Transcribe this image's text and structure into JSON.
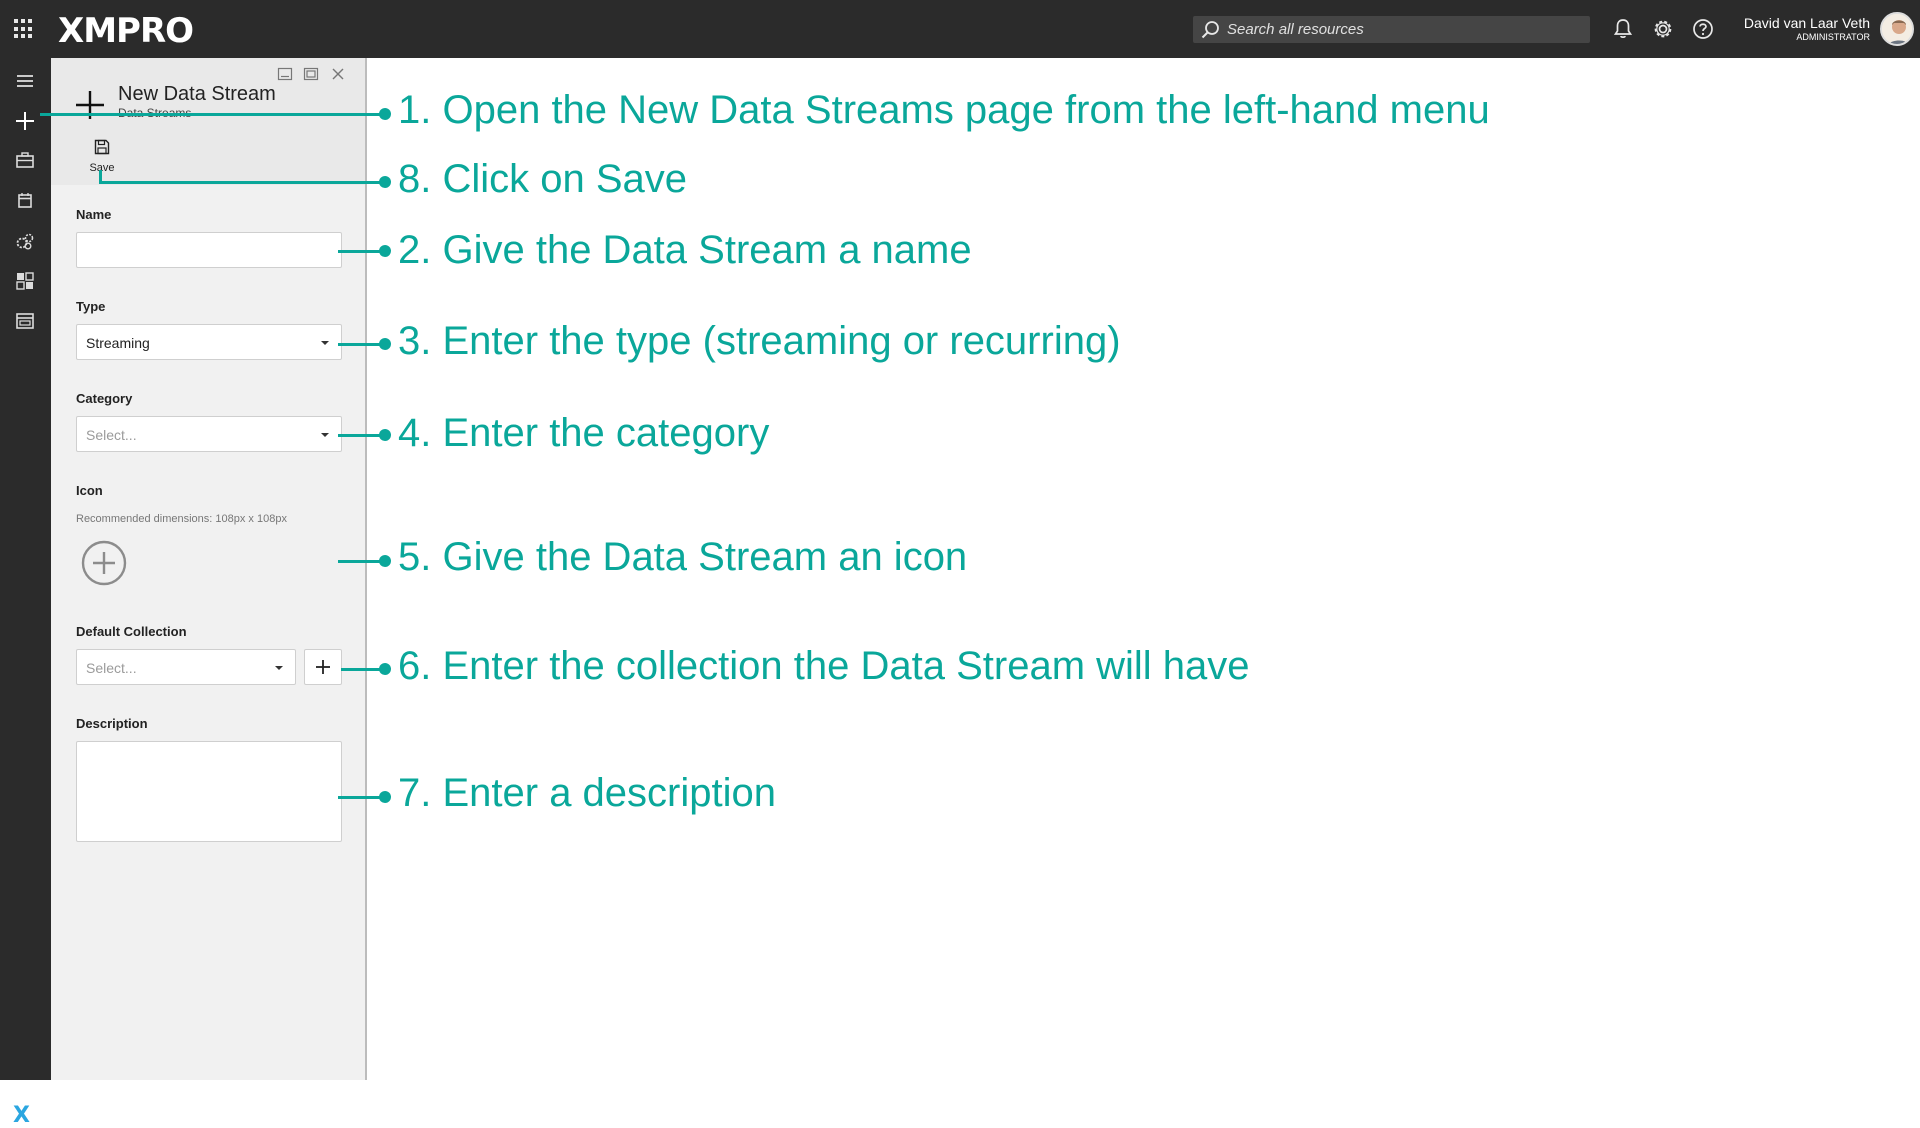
{
  "app": {
    "logo": "XMPRO",
    "search_placeholder": "Search all resources",
    "user_name": "David van Laar Veth",
    "user_role": "ADMINISTRATOR"
  },
  "panel": {
    "title": "New Data Stream",
    "subtitle": "Data Streams",
    "save_label": "Save",
    "fields": {
      "name_label": "Name",
      "name_value": "",
      "type_label": "Type",
      "type_value": "Streaming",
      "category_label": "Category",
      "category_placeholder": "Select...",
      "icon_label": "Icon",
      "icon_hint": "Recommended dimensions: 108px x 108px",
      "collection_label": "Default Collection",
      "collection_placeholder": "Select...",
      "description_label": "Description",
      "description_value": ""
    }
  },
  "annotations": {
    "step1": "1. Open the New Data Streams page from the left-hand menu",
    "step8": "8. Click on Save",
    "step2": "2. Give the Data Stream a name",
    "step3": "3. Enter the type (streaming or recurring)",
    "step4": "4. Enter the category",
    "step5": "5. Give the Data Stream an icon",
    "step6": "6. Enter the collection the Data Stream will have",
    "step7": "7. Enter a description"
  },
  "colors": {
    "annotation": "#0aa79a",
    "topbar": "#2b2b2b",
    "brand_x": "#2aa6e0"
  },
  "icons": [
    "apps-grid-icon",
    "bell-icon",
    "gear-icon",
    "help-icon",
    "search-icon",
    "menu-icon",
    "plus-icon",
    "briefcase-icon",
    "calendar-icon",
    "gears-icon",
    "dashboard-icon",
    "app-window-icon",
    "save-icon",
    "add-circle-icon",
    "chevron-down-icon"
  ]
}
